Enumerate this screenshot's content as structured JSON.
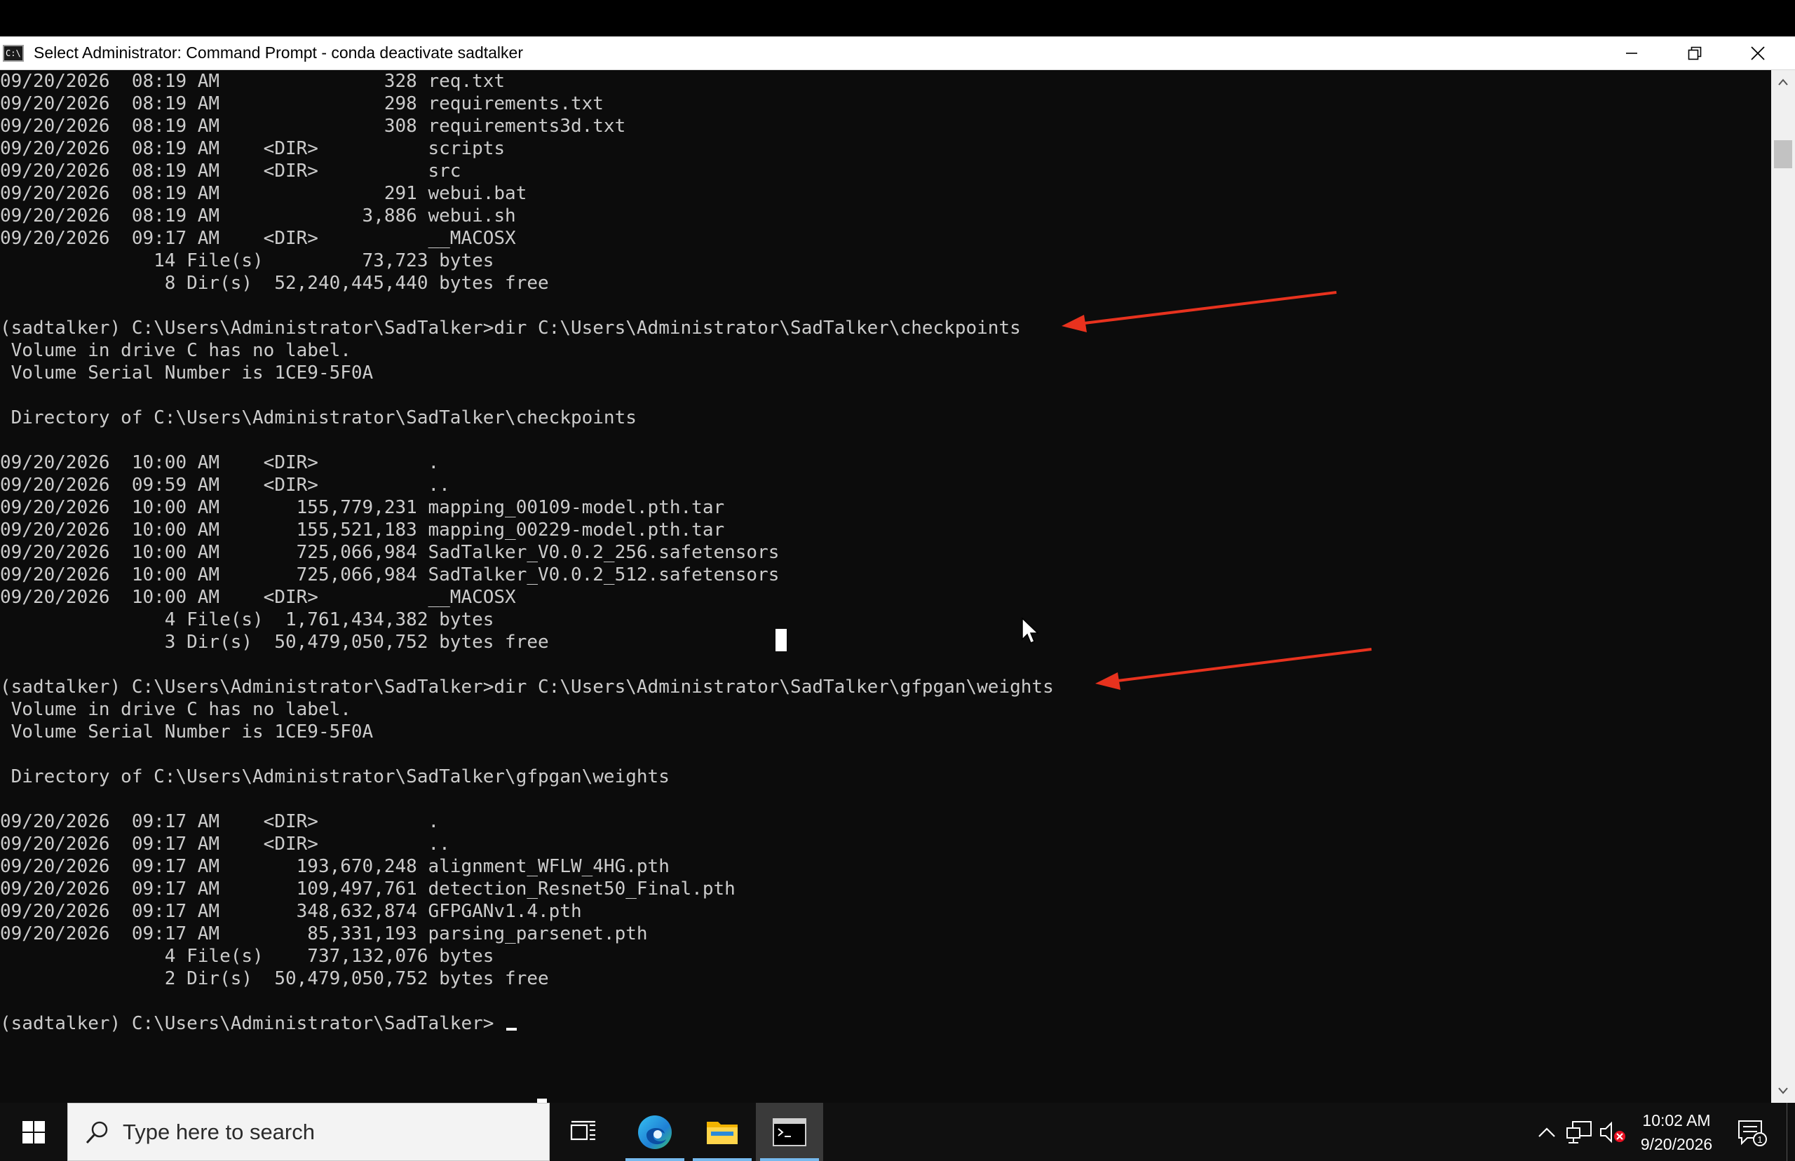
{
  "window": {
    "title": "Select Administrator: Command Prompt - conda  deactivate sadtalker",
    "icon_text": "C:\\."
  },
  "console": {
    "lines": [
      "09/20/2026  08:19 AM               328 req.txt",
      "09/20/2026  08:19 AM               298 requirements.txt",
      "09/20/2026  08:19 AM               308 requirements3d.txt",
      "09/20/2026  08:19 AM    <DIR>          scripts",
      "09/20/2026  08:19 AM    <DIR>          src",
      "09/20/2026  08:19 AM               291 webui.bat",
      "09/20/2026  08:19 AM             3,886 webui.sh",
      "09/20/2026  09:17 AM    <DIR>          __MACOSX",
      "              14 File(s)         73,723 bytes",
      "               8 Dir(s)  52,240,445,440 bytes free",
      "",
      "(sadtalker) C:\\Users\\Administrator\\SadTalker>dir C:\\Users\\Administrator\\SadTalker\\checkpoints",
      " Volume in drive C has no label.",
      " Volume Serial Number is 1CE9-5F0A",
      "",
      " Directory of C:\\Users\\Administrator\\SadTalker\\checkpoints",
      "",
      "09/20/2026  10:00 AM    <DIR>          .",
      "09/20/2026  09:59 AM    <DIR>          ..",
      "09/20/2026  10:00 AM       155,779,231 mapping_00109-model.pth.tar",
      "09/20/2026  10:00 AM       155,521,183 mapping_00229-model.pth.tar",
      "09/20/2026  10:00 AM       725,066,984 SadTalker_V0.0.2_256.safetensors",
      "09/20/2026  10:00 AM       725,066,984 SadTalker_V0.0.2_512.safetensors",
      "09/20/2026  10:00 AM    <DIR>          __MACOSX",
      "               4 File(s)  1,761,434,382 bytes",
      "               3 Dir(s)  50,479,050,752 bytes free",
      "",
      "(sadtalker) C:\\Users\\Administrator\\SadTalker>dir C:\\Users\\Administrator\\SadTalker\\gfpgan\\weights",
      " Volume in drive C has no label.",
      " Volume Serial Number is 1CE9-5F0A",
      "",
      " Directory of C:\\Users\\Administrator\\SadTalker\\gfpgan\\weights",
      "",
      "09/20/2026  09:17 AM    <DIR>          .",
      "09/20/2026  09:17 AM    <DIR>          ..",
      "09/20/2026  09:17 AM       193,670,248 alignment_WFLW_4HG.pth",
      "09/20/2026  09:17 AM       109,497,761 detection_Resnet50_Final.pth",
      "09/20/2026  09:17 AM       348,632,874 GFPGANv1.4.pth",
      "09/20/2026  09:17 AM        85,331,193 parsing_parsenet.pth",
      "               4 File(s)    737,132,076 bytes",
      "               2 Dir(s)  50,479,050,752 bytes free",
      "",
      "(sadtalker) C:\\Users\\Administrator\\SadTalker>"
    ]
  },
  "taskbar": {
    "search_placeholder": "Type here to search",
    "apps": [
      "task-view",
      "edge",
      "file-explorer",
      "command-prompt"
    ],
    "clock_time": "10:02 AM",
    "clock_date": "9/20/2026",
    "notification_count": "1"
  },
  "colors": {
    "console_bg": "#0c0c0c",
    "console_text": "#cccccc",
    "annotation_arrow": "#e8321e",
    "taskbar_bg": "#101010",
    "active_underline": "#76b9ed"
  },
  "icons": {
    "window": "cmd-window-icon",
    "minimize": "minimize-icon",
    "restore": "restore-icon",
    "close": "close-icon",
    "start": "windows-logo-icon",
    "search": "search-icon",
    "tray_chevron": "chevron-up-icon",
    "network": "network-icon",
    "volume": "volume-muted-icon",
    "notifications": "notification-icon"
  }
}
